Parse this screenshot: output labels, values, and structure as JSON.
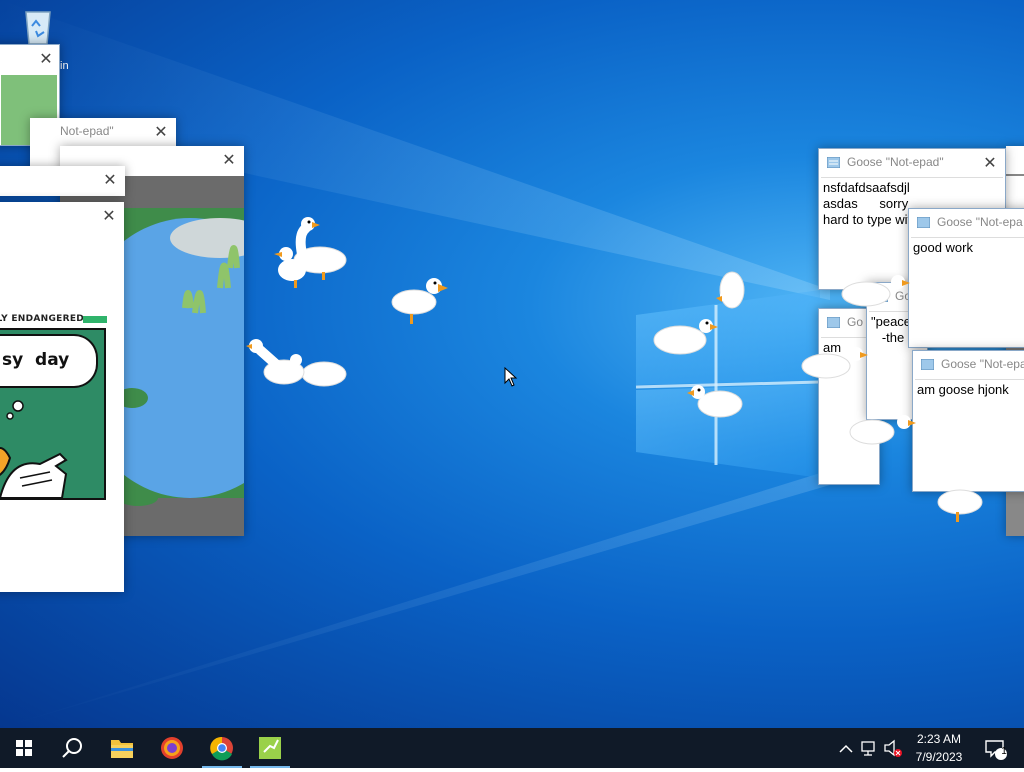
{
  "desktop": {
    "recycle_bin_label_fragment": "in"
  },
  "windows": {
    "notepad_top_left": {
      "title": "Not-epad\""
    },
    "notepad_1": {
      "title": "Goose \"Not-epad\"",
      "text": "nsfdafdsaafsdjl\nasdas      sorry\nhard to type wit"
    },
    "notepad_2": {
      "title": "Goose \"Not-epa",
      "text": "good work"
    },
    "notepad_3": {
      "title": "Go",
      "text": "\"peace\n   -the g"
    },
    "notepad_4": {
      "title": "Go",
      "text": "am"
    },
    "notepad_5": {
      "title": "Goose \"Not-epa",
      "text": "am goose hjonk"
    },
    "meme_window": {
      "banner": "ELY ENDANGERED",
      "speech": "sy  day"
    }
  },
  "taskbar": {
    "time": "2:23 AM",
    "date": "7/9/2023",
    "notification_count": "1",
    "apps": [
      "start",
      "search",
      "file-explorer",
      "firefox",
      "chrome",
      "desktop-goose"
    ]
  },
  "colors": {
    "desktop_blue": "#0a62c6",
    "taskbar": "#101a28",
    "chrome_active_underline": "#76b9ed"
  }
}
